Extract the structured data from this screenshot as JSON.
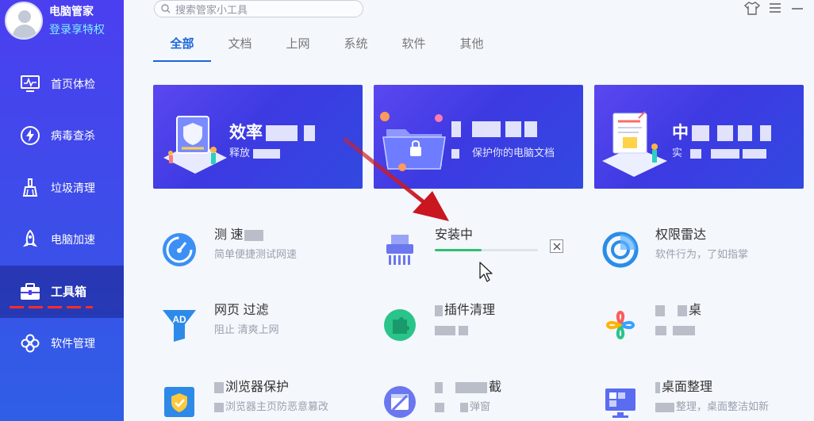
{
  "profile": {
    "app_name": "电脑管家",
    "login_text": "登录享特权",
    "avatar_icon": "user-avatar-icon"
  },
  "nav": {
    "items": [
      {
        "label": "首页体检",
        "icon": "monitor-check-icon"
      },
      {
        "label": "病毒查杀",
        "icon": "lightning-shield-icon"
      },
      {
        "label": "垃圾清理",
        "icon": "broom-icon"
      },
      {
        "label": "电脑加速",
        "icon": "rocket-icon"
      },
      {
        "label": "工具箱",
        "icon": "toolbox-icon"
      },
      {
        "label": "软件管理",
        "icon": "apps-icon"
      }
    ],
    "active": "工具箱"
  },
  "search": {
    "placeholder": "搜索管家小工具"
  },
  "window": {
    "skin_icon": "shirt-icon",
    "menu_icon": "menu-icon",
    "minimize_icon": "minimize-icon"
  },
  "tabs": [
    {
      "label": "全部",
      "active": true
    },
    {
      "label": "文档",
      "active": false
    },
    {
      "label": "上网",
      "active": false
    },
    {
      "label": "系统",
      "active": false
    },
    {
      "label": "软件",
      "active": false
    },
    {
      "label": "其他",
      "active": false
    }
  ],
  "banners": [
    {
      "title": "效率",
      "subtitle": "释放"
    },
    {
      "title": "",
      "subtitle": "保护你的电脑文档"
    },
    {
      "title": "中",
      "subtitle": "实"
    }
  ],
  "tools": [
    {
      "name": "测 速",
      "desc": "简单便捷测试网速",
      "icon": "speedometer-icon"
    },
    {
      "name": "安装中",
      "desc": "",
      "icon": "shredder-icon",
      "installing": true,
      "progress": 0.45
    },
    {
      "name": "权限雷达",
      "desc": "软件行为，了如指掌",
      "icon": "radar-icon"
    },
    {
      "name": "网页 过滤",
      "desc": "阻止 清爽上网",
      "icon": "ad-filter-icon"
    },
    {
      "name": "插件清理",
      "desc": "",
      "icon": "puzzle-icon"
    },
    {
      "name": "桌",
      "desc": "",
      "icon": "clover-icon"
    },
    {
      "name": "浏览器保护",
      "desc": "浏览器主页防恶意篡改",
      "icon": "browser-shield-icon"
    },
    {
      "name": "截",
      "desc": "弹窗",
      "icon": "window-block-icon"
    },
    {
      "name": "桌面整理",
      "desc": "整理，桌面整洁如新",
      "icon": "desktop-organize-icon"
    }
  ],
  "colors": {
    "sidebar": "#4b3ff0",
    "accent": "#1c66d8",
    "progress": "#2fbf71",
    "annotation_arrow": "#d0202a"
  }
}
